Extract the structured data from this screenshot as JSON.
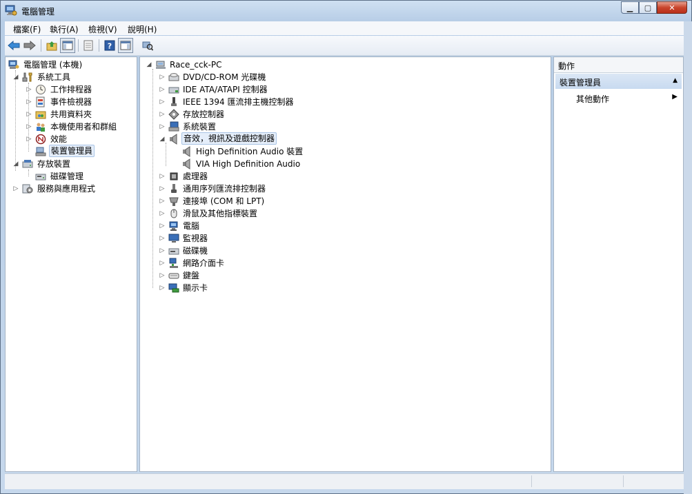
{
  "window": {
    "title": "電腦管理"
  },
  "menu": [
    "檔案(F)",
    "執行(A)",
    "檢視(V)",
    "說明(H)"
  ],
  "left_tree": [
    {
      "label": "電腦管理 (本機)",
      "icon": "computer-management-icon",
      "level": 0,
      "expander": ""
    },
    {
      "label": "系統工具",
      "icon": "tools-icon",
      "level": 1,
      "expander": "open"
    },
    {
      "label": "工作排程器",
      "icon": "clock-icon",
      "level": 2,
      "expander": "closed"
    },
    {
      "label": "事件檢視器",
      "icon": "event-viewer-icon",
      "level": 2,
      "expander": "closed"
    },
    {
      "label": "共用資料夾",
      "icon": "shared-folder-icon",
      "level": 2,
      "expander": "closed"
    },
    {
      "label": "本機使用者和群組",
      "icon": "users-icon",
      "level": 2,
      "expander": "closed"
    },
    {
      "label": "效能",
      "icon": "performance-icon",
      "level": 2,
      "expander": "closed"
    },
    {
      "label": "裝置管理員",
      "icon": "device-manager-icon",
      "level": 2,
      "expander": "",
      "selected": true
    },
    {
      "label": "存放裝置",
      "icon": "storage-icon",
      "level": 1,
      "expander": "open"
    },
    {
      "label": "磁碟管理",
      "icon": "disk-management-icon",
      "level": 2,
      "expander": ""
    },
    {
      "label": "服務與應用程式",
      "icon": "services-icon",
      "level": 1,
      "expander": "closed"
    }
  ],
  "device_tree": {
    "root": "Race_cck-PC",
    "categories": [
      {
        "label": "DVD/CD-ROM 光碟機",
        "icon": "dvd-drive-icon"
      },
      {
        "label": "IDE ATA/ATAPI 控制器",
        "icon": "ide-controller-icon"
      },
      {
        "label": "IEEE 1394 匯流排主機控制器",
        "icon": "firewire-icon"
      },
      {
        "label": "存放控制器",
        "icon": "storage-controller-icon"
      },
      {
        "label": "系統裝置",
        "icon": "system-devices-icon"
      },
      {
        "label": "音效，視訊及遊戲控制器",
        "icon": "speaker-icon",
        "expanded": true,
        "selected": true,
        "children": [
          "High Definition Audio 裝置",
          "VIA High Definition Audio"
        ]
      },
      {
        "label": "處理器",
        "icon": "processor-icon"
      },
      {
        "label": "通用序列匯流排控制器",
        "icon": "usb-icon"
      },
      {
        "label": "連接埠 (COM 和 LPT)",
        "icon": "port-icon"
      },
      {
        "label": "滑鼠及其他指標裝置",
        "icon": "mouse-icon"
      },
      {
        "label": "電腦",
        "icon": "computer-icon"
      },
      {
        "label": "監視器",
        "icon": "monitor-icon"
      },
      {
        "label": "磁碟機",
        "icon": "disk-drive-icon"
      },
      {
        "label": "網路介面卡",
        "icon": "network-adapter-icon"
      },
      {
        "label": "鍵盤",
        "icon": "keyboard-icon"
      },
      {
        "label": "顯示卡",
        "icon": "display-adapter-icon"
      }
    ]
  },
  "actions": {
    "header": "動作",
    "section": "裝置管理員",
    "items": [
      "其他動作"
    ]
  }
}
